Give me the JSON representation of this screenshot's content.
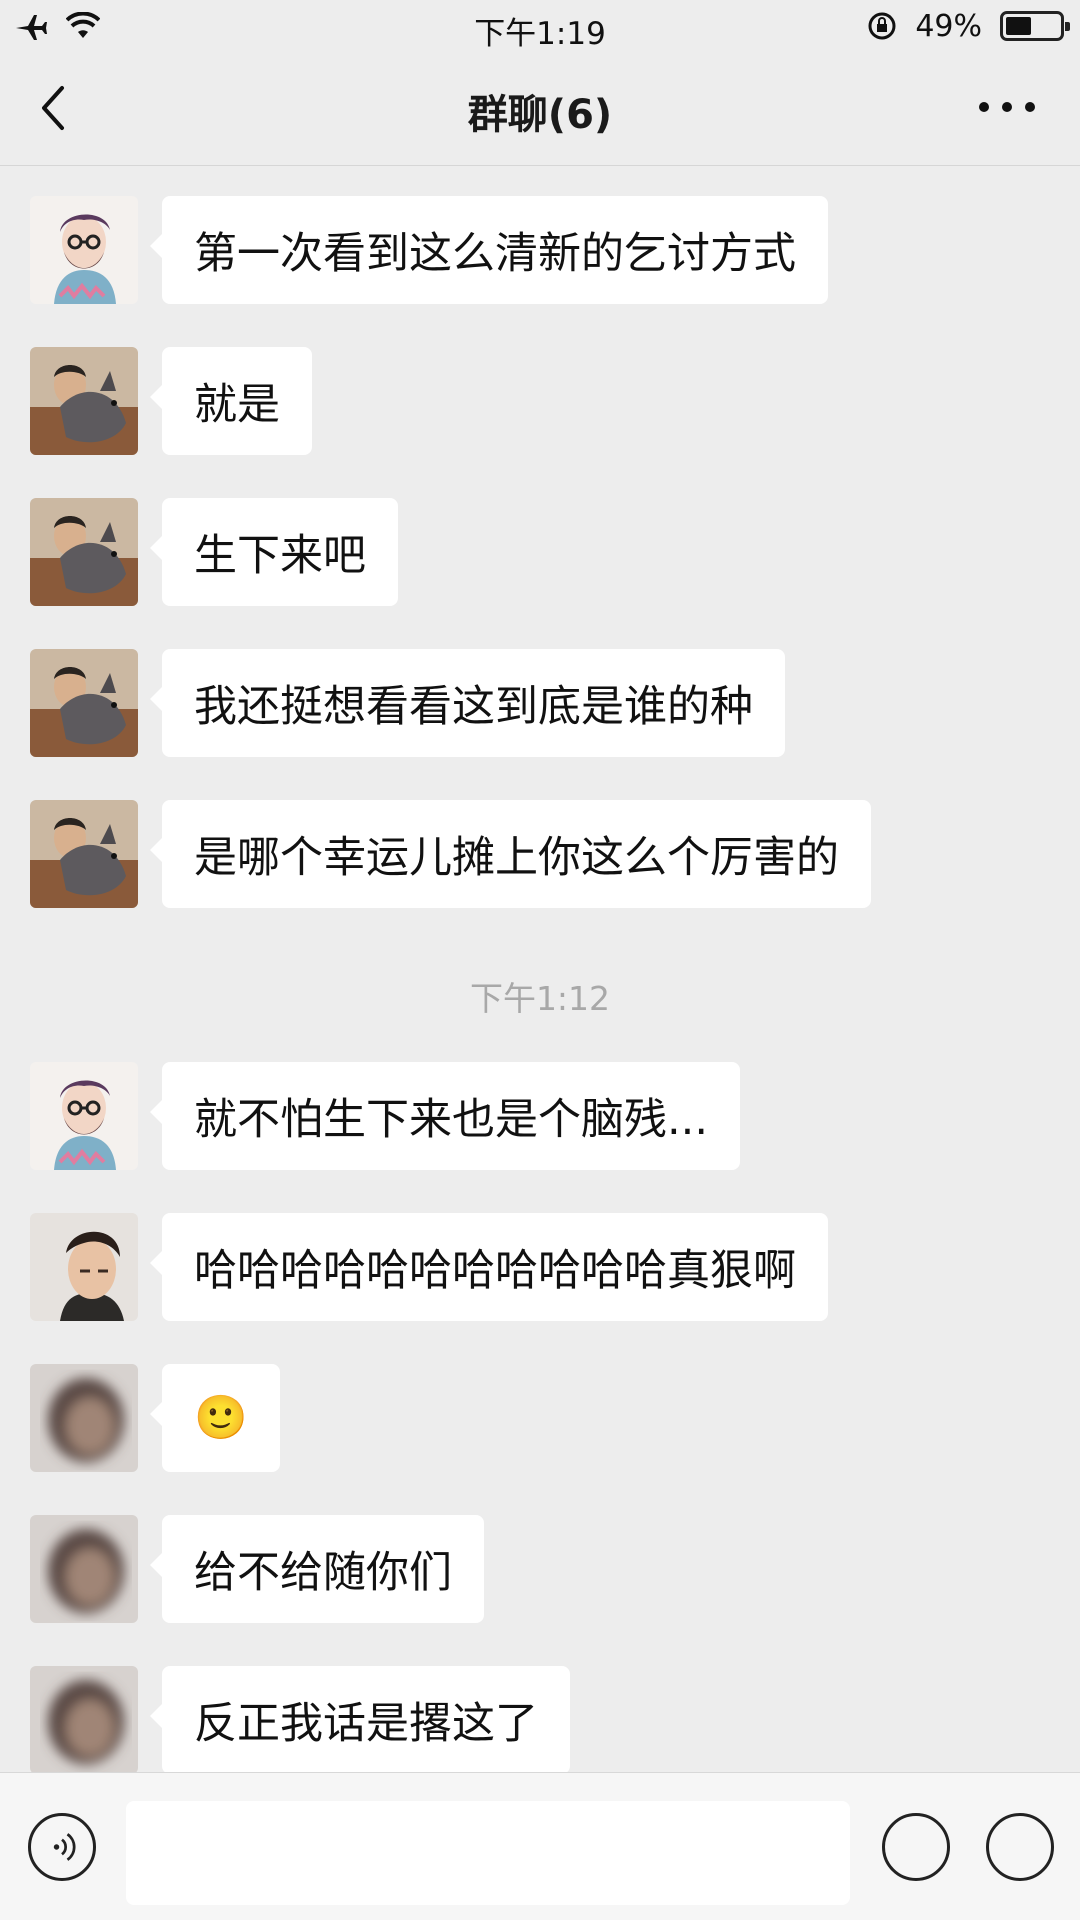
{
  "status_bar": {
    "time": "下午1:19",
    "battery_percent": "49%",
    "battery_level": 0.49
  },
  "nav": {
    "title": "群聊(6)"
  },
  "messages": [
    {
      "avatar": "avatar-cartoon-man-icon",
      "text": "第一次看到这么清新的乞讨方式"
    },
    {
      "avatar": "avatar-man-with-dog-icon",
      "text": "就是"
    },
    {
      "avatar": "avatar-man-with-dog-icon",
      "text": "生下来吧"
    },
    {
      "avatar": "avatar-man-with-dog-icon",
      "text": "我还挺想看看这到底是谁的种"
    },
    {
      "avatar": "avatar-man-with-dog-icon",
      "text": "是哪个幸运儿摊上你这么个厉害的"
    },
    {
      "avatar": "avatar-cartoon-man-icon",
      "text": "就不怕生下来也是个脑残..."
    },
    {
      "avatar": "avatar-young-man-icon",
      "text": "哈哈哈哈哈哈哈哈哈哈哈真狠啊"
    },
    {
      "avatar": "avatar-blurred-icon",
      "text": "🙂"
    },
    {
      "avatar": "avatar-blurred-icon",
      "text": "给不给随你们"
    },
    {
      "avatar": "avatar-blurred-icon",
      "text": "反正我话是撂这了"
    }
  ],
  "timestamp_divider": "下午1:12",
  "input_bar": {
    "text_value": ""
  }
}
